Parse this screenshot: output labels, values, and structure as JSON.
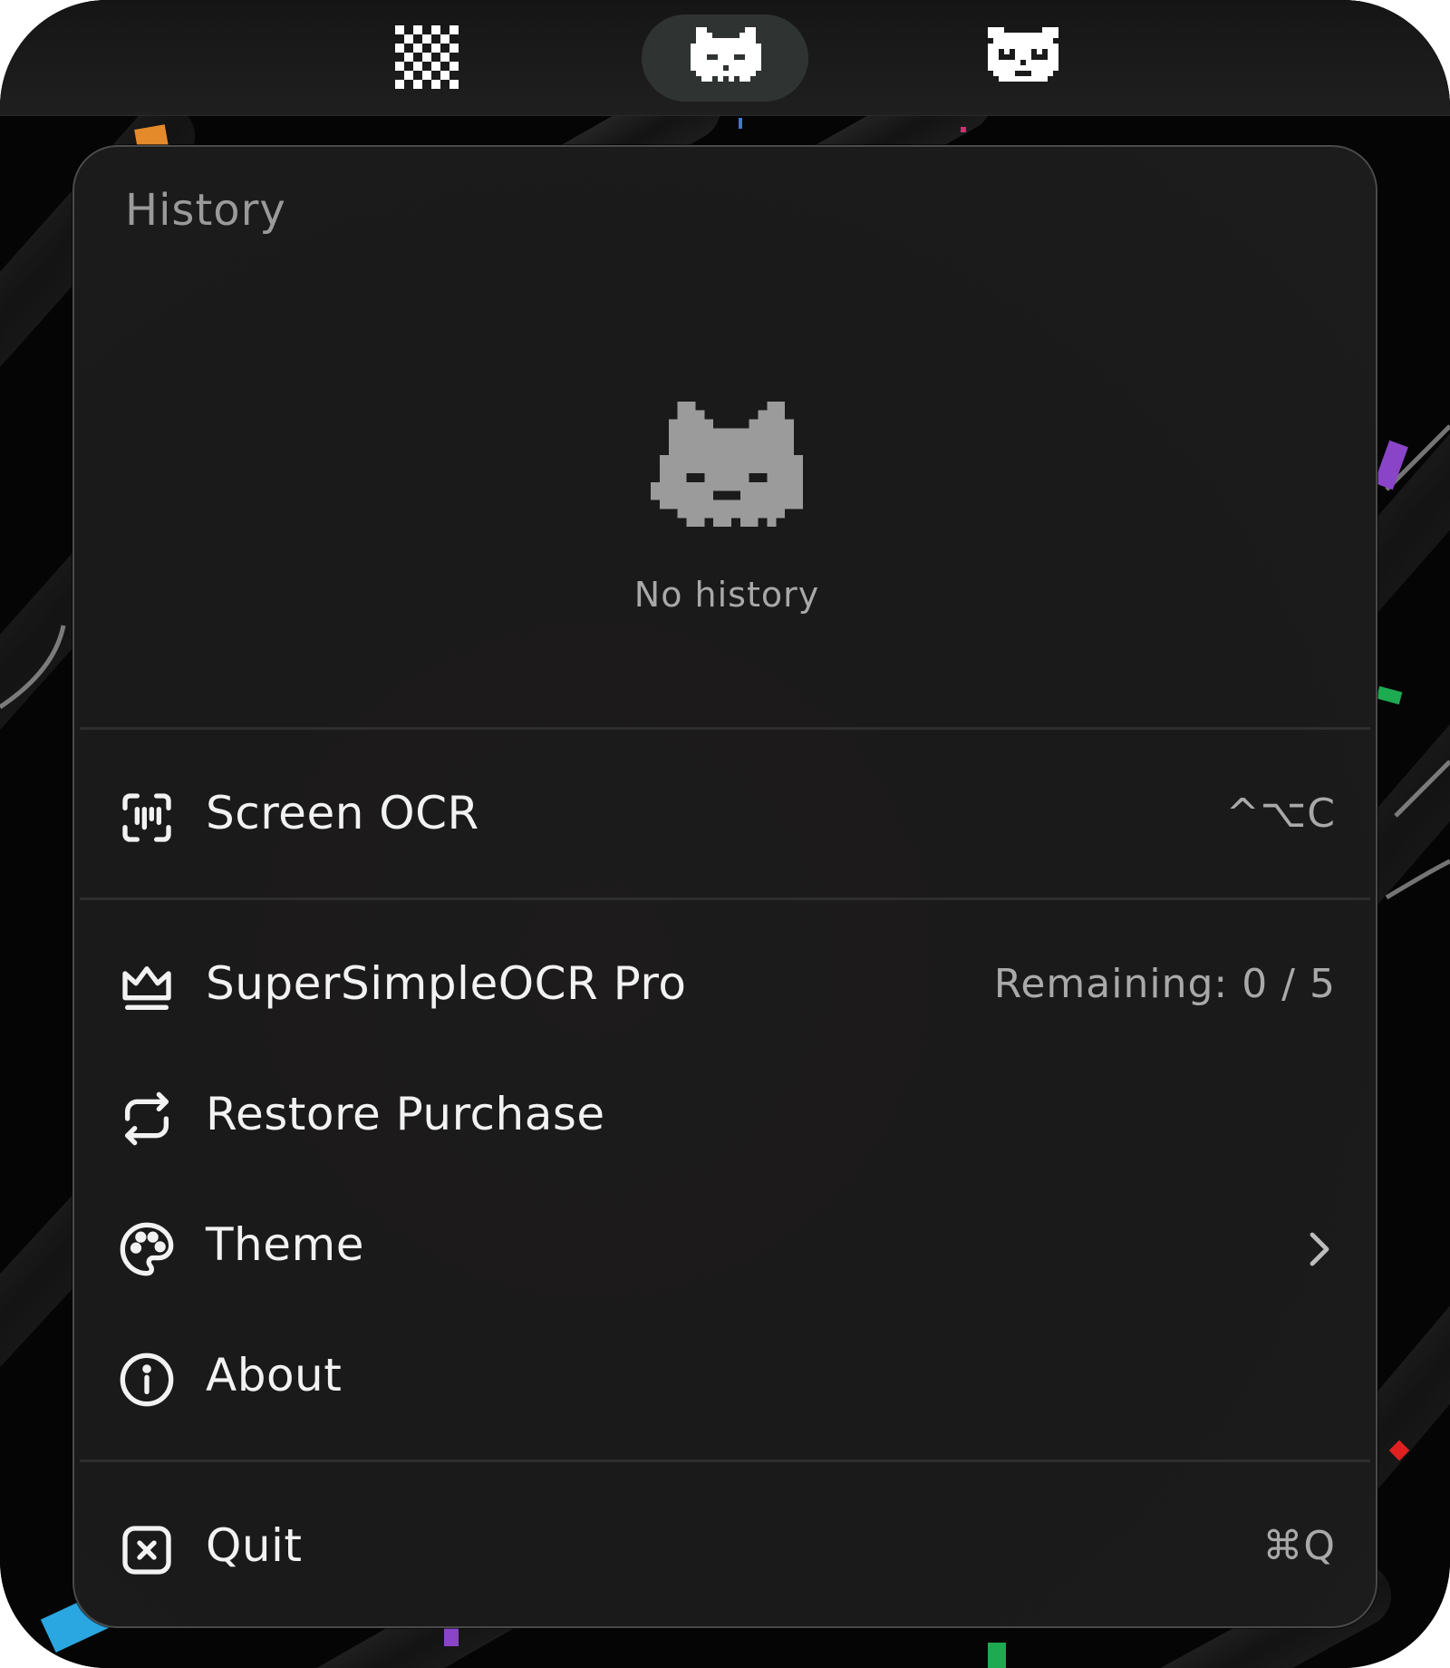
{
  "menubar": {
    "items": [
      {
        "icon": "checker-icon"
      },
      {
        "icon": "pixel-cat-icon",
        "active": true
      },
      {
        "icon": "pixel-bear-icon"
      }
    ]
  },
  "panel": {
    "history_title": "History",
    "empty_icon": "pixel-cat-face-icon",
    "empty_text": "No history",
    "items": [
      {
        "icon": "screen-ocr-icon",
        "label": "Screen OCR",
        "shortcut": "^⌥C"
      },
      {
        "icon": "crown-icon",
        "label": "SuperSimpleOCR Pro",
        "aux": "Remaining: 0 / 5"
      },
      {
        "icon": "restore-icon",
        "label": "Restore Purchase"
      },
      {
        "icon": "palette-icon",
        "label": "Theme",
        "trailing": "chevron-right-icon"
      },
      {
        "icon": "info-icon",
        "label": "About"
      },
      {
        "icon": "quit-icon",
        "label": "Quit",
        "shortcut": "⌘Q"
      }
    ]
  },
  "colors": {
    "panel_bg": "#1a1a1a",
    "text_primary": "#f2f2f2",
    "text_secondary": "#a9a9a9",
    "separator": "#2e2e2e"
  }
}
